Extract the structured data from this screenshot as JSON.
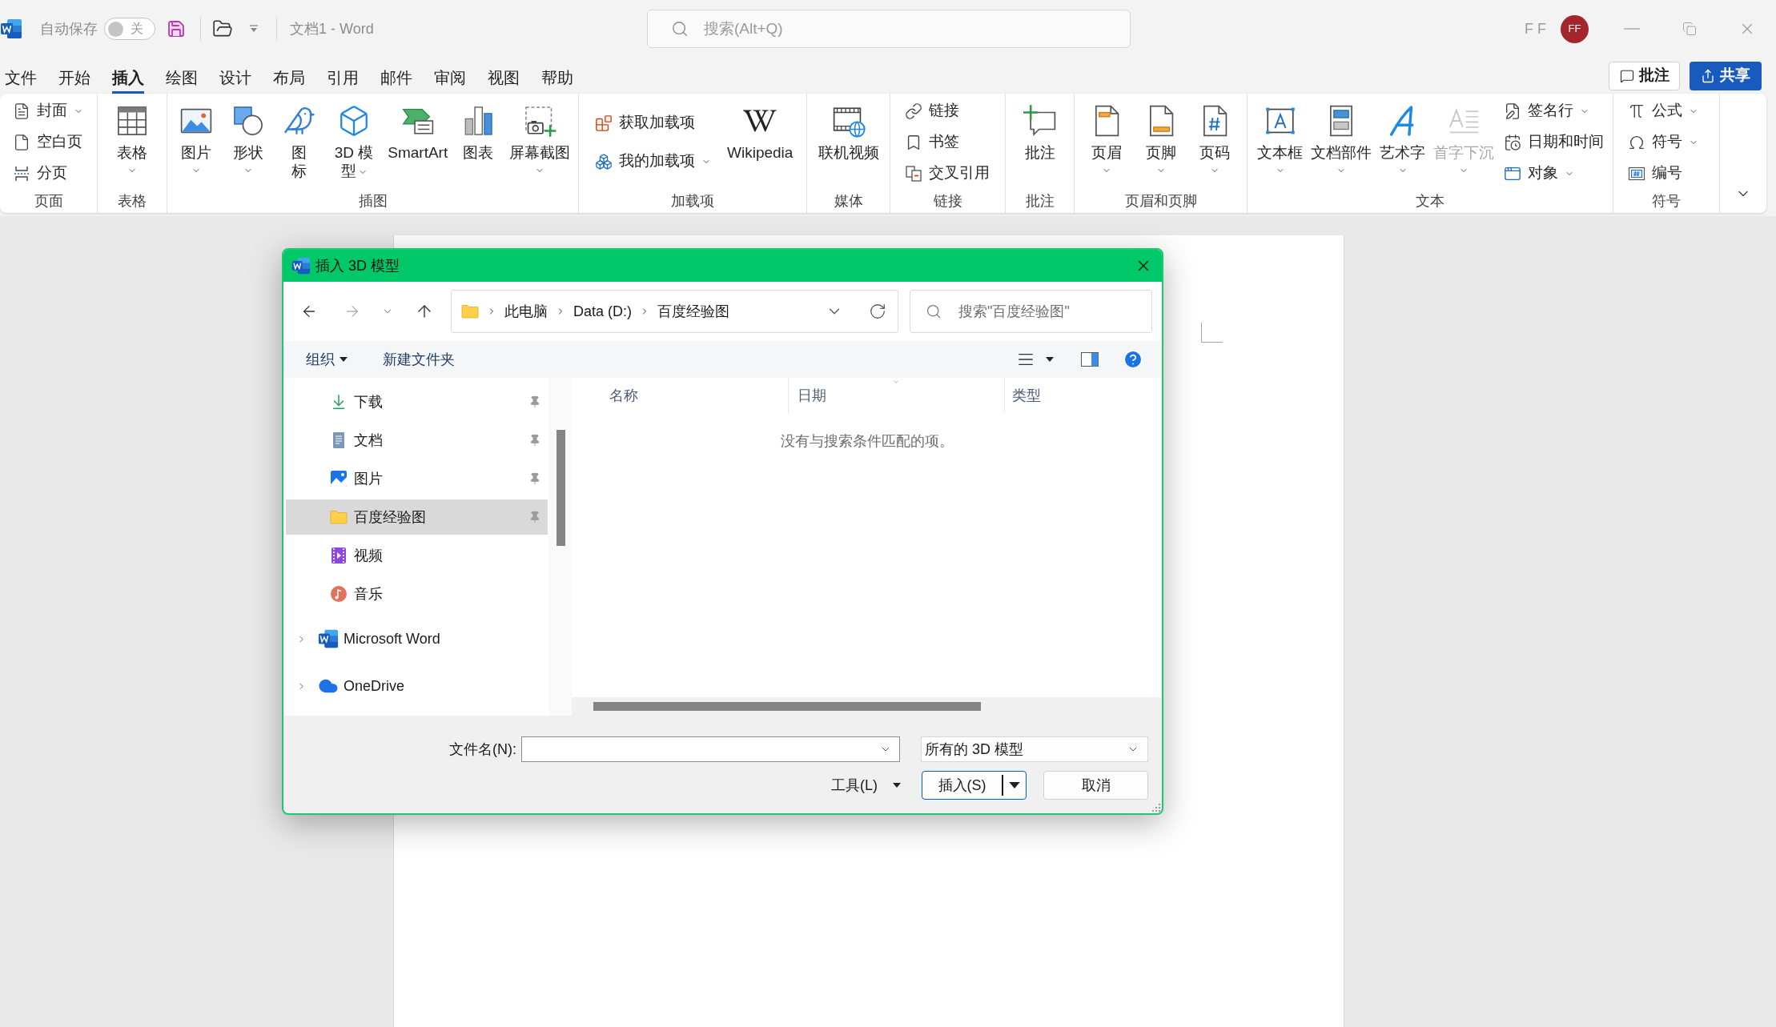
{
  "title_bar": {
    "autosave_label": "自动保存",
    "autosave": {
      "on": false,
      "label": "关"
    },
    "document_title": "文档1 - Word",
    "search": {
      "placeholder": "搜索(Alt+Q)"
    },
    "user_name": "F F",
    "avatar_initials": "FF"
  },
  "menu_tabs": [
    {
      "label": "文件",
      "selected": false
    },
    {
      "label": "开始",
      "selected": false
    },
    {
      "label": "插入",
      "selected": true
    },
    {
      "label": "绘图",
      "selected": false
    },
    {
      "label": "设计",
      "selected": false
    },
    {
      "label": "布局",
      "selected": false
    },
    {
      "label": "引用",
      "selected": false
    },
    {
      "label": "邮件",
      "selected": false
    },
    {
      "label": "审阅",
      "selected": false
    },
    {
      "label": "视图",
      "selected": false
    },
    {
      "label": "帮助",
      "selected": false
    }
  ],
  "header_buttons": {
    "comments": "批注",
    "share": "共享"
  },
  "ribbon": {
    "groups": [
      {
        "label": "页面",
        "items": [
          {
            "kind": "small",
            "label": "封面",
            "menu": true,
            "disabled": false
          },
          {
            "kind": "small",
            "label": "空白页",
            "menu": false,
            "disabled": false
          },
          {
            "kind": "small",
            "label": "分页",
            "menu": false,
            "disabled": false
          }
        ]
      },
      {
        "label": "表格",
        "items": [
          {
            "kind": "large",
            "label": "表格",
            "menu": true,
            "disabled": false
          }
        ]
      },
      {
        "label": "插图",
        "items": [
          {
            "kind": "large",
            "label": "图片",
            "menu": true,
            "disabled": false
          },
          {
            "kind": "large",
            "label": "形状",
            "menu": true,
            "disabled": false
          },
          {
            "kind": "large",
            "label": "图标",
            "menu": false,
            "disabled": false
          },
          {
            "kind": "large",
            "label": "3D 模型",
            "menu": true,
            "disabled": false
          },
          {
            "kind": "large",
            "label": "SmartArt",
            "menu": false,
            "disabled": false
          },
          {
            "kind": "large",
            "label": "图表",
            "menu": false,
            "disabled": false
          },
          {
            "kind": "large",
            "label": "屏幕截图",
            "menu": true,
            "disabled": false
          }
        ]
      },
      {
        "label": "加载项",
        "items": [
          {
            "kind": "small",
            "label": "获取加载项",
            "menu": false,
            "disabled": false
          },
          {
            "kind": "small",
            "label": "我的加载项",
            "menu": true,
            "disabled": false
          },
          {
            "kind": "large",
            "label": "Wikipedia",
            "menu": false,
            "disabled": false
          }
        ]
      },
      {
        "label": "媒体",
        "items": [
          {
            "kind": "large",
            "label": "联机视频",
            "menu": false,
            "disabled": false
          }
        ]
      },
      {
        "label": "链接",
        "items": [
          {
            "kind": "small",
            "label": "链接",
            "menu": false,
            "disabled": false
          },
          {
            "kind": "small",
            "label": "书签",
            "menu": false,
            "disabled": false
          },
          {
            "kind": "small",
            "label": "交叉引用",
            "menu": false,
            "disabled": false
          }
        ]
      },
      {
        "label": "批注",
        "items": [
          {
            "kind": "large",
            "label": "批注",
            "menu": false,
            "disabled": false
          }
        ]
      },
      {
        "label": "页眉和页脚",
        "items": [
          {
            "kind": "large",
            "label": "页眉",
            "menu": true,
            "disabled": false
          },
          {
            "kind": "large",
            "label": "页脚",
            "menu": true,
            "disabled": false
          },
          {
            "kind": "large",
            "label": "页码",
            "menu": true,
            "disabled": false
          }
        ]
      },
      {
        "label": "文本",
        "items": [
          {
            "kind": "large",
            "label": "文本框",
            "menu": true,
            "disabled": false
          },
          {
            "kind": "large",
            "label": "文档部件",
            "menu": true,
            "disabled": false
          },
          {
            "kind": "large",
            "label": "艺术字",
            "menu": true,
            "disabled": false
          },
          {
            "kind": "large",
            "label": "首字下沉",
            "menu": true,
            "disabled": true
          },
          {
            "kind": "small",
            "label": "签名行",
            "menu": true,
            "disabled": false
          },
          {
            "kind": "small",
            "label": "日期和时间",
            "menu": false,
            "disabled": false
          },
          {
            "kind": "small",
            "label": "对象",
            "menu": true,
            "disabled": false
          }
        ]
      },
      {
        "label": "符号",
        "items": [
          {
            "kind": "small",
            "label": "公式",
            "menu": true,
            "disabled": false
          },
          {
            "kind": "small",
            "label": "符号",
            "menu": true,
            "disabled": false
          },
          {
            "kind": "small",
            "label": "编号",
            "menu": false,
            "disabled": false
          }
        ]
      }
    ]
  },
  "dialog": {
    "title": "插入 3D 模型",
    "back_button": {
      "disabled": false
    },
    "forward_button": {
      "disabled": true
    },
    "path": [
      "此电脑",
      "Data (D:)",
      "百度经验图"
    ],
    "search": {
      "placeholder": "搜索\"百度经验图\""
    },
    "organize_button": "组织",
    "new_folder_button": "新建文件夹",
    "quick_access": [
      {
        "label": "下载",
        "pinned": true,
        "selected": false
      },
      {
        "label": "文档",
        "pinned": true,
        "selected": false
      },
      {
        "label": "图片",
        "pinned": true,
        "selected": false
      },
      {
        "label": "百度经验图",
        "pinned": true,
        "selected": true
      },
      {
        "label": "视频",
        "pinned": false,
        "selected": false
      },
      {
        "label": "音乐",
        "pinned": false,
        "selected": false
      }
    ],
    "locations": [
      {
        "label": "Microsoft Word",
        "expanded": false,
        "selected": false
      },
      {
        "label": "OneDrive",
        "expanded": false,
        "selected": false
      }
    ],
    "columns": [
      {
        "label": "名称",
        "sorted": false
      },
      {
        "label": "日期",
        "sorted": true
      },
      {
        "label": "类型",
        "sorted": false
      }
    ],
    "empty_message": "没有与搜索条件匹配的项。",
    "file_name_label": "文件名(N):",
    "file_type": "所有的 3D 模型",
    "tools_button": "工具(L)",
    "insert_button": "插入(S)",
    "cancel_button": "取消"
  }
}
